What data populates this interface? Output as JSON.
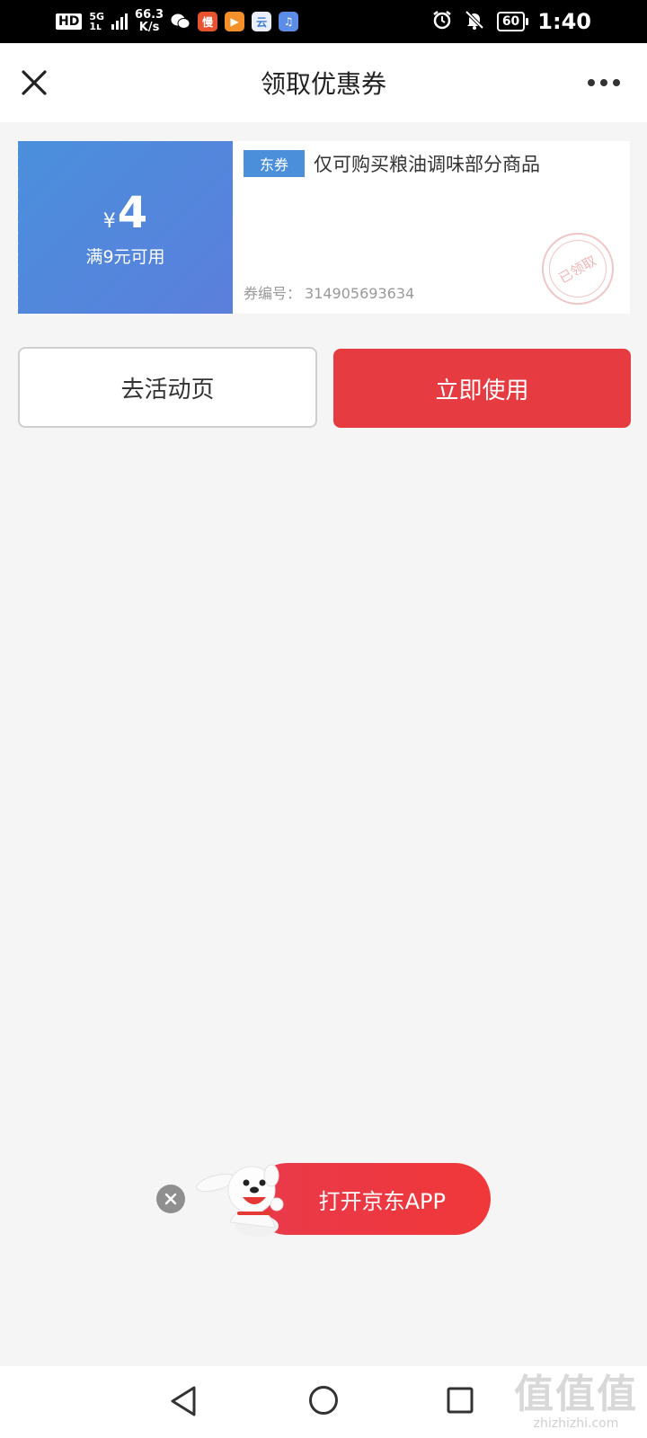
{
  "status_bar": {
    "hd": "HD",
    "network_top": "5G",
    "network_bottom": "1ʟ",
    "speed_value": "66.3",
    "speed_unit": "K/s",
    "app_icons": [
      {
        "name": "wechat-icon",
        "glyph": "",
        "color": "#000000"
      },
      {
        "name": "app-man-icon",
        "glyph": "慢",
        "color": "#e8532f"
      },
      {
        "name": "app-video-icon",
        "glyph": "▶",
        "color": "#f4902a"
      },
      {
        "name": "app-cloud-icon",
        "glyph": "云",
        "color": "#3a7bd5"
      },
      {
        "name": "app-music-icon",
        "glyph": "♫",
        "color": "#5b8de6"
      }
    ],
    "battery": "60",
    "time": "1:40"
  },
  "header": {
    "title": "领取优惠券"
  },
  "coupon": {
    "currency": "¥",
    "value": "4",
    "condition": "满9元可用",
    "tag": "东券",
    "description": "仅可购买粮油调味部分商品",
    "code_label": "券编号：",
    "code": "314905693634",
    "stamp": "已领取"
  },
  "actions": {
    "activity_label": "去活动页",
    "use_label": "立即使用"
  },
  "app_banner": {
    "label": "打开京东APP"
  },
  "watermark": {
    "logo": "值值值",
    "url": "zhizhizhi.com"
  },
  "colors": {
    "accent_red": "#e63b41",
    "coupon_blue": "#4b8fdb"
  }
}
